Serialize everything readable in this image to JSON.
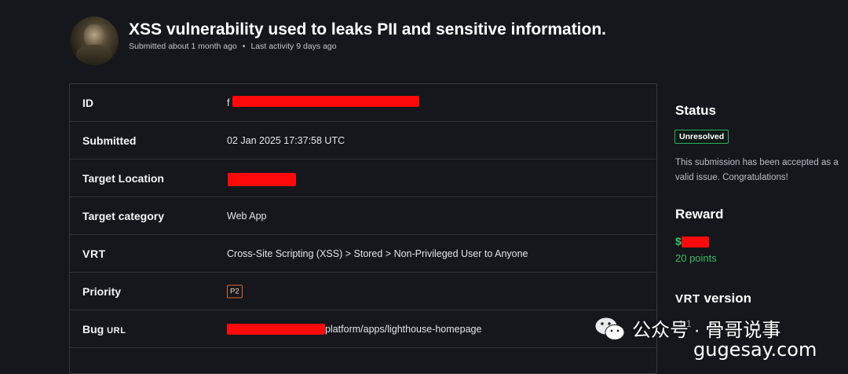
{
  "header": {
    "title": "XSS vulnerability used to leaks PII and sensitive information.",
    "submitted": "Submitted about 1 month ago",
    "separator": "•",
    "last_activity": "Last activity 9 days ago"
  },
  "details": {
    "id": {
      "label": "ID",
      "value_prefix": "f",
      "redacted": true
    },
    "submitted": {
      "label": "Submitted",
      "value": "02 Jan 2025 17:37:58 UTC"
    },
    "target_location": {
      "label": "Target Location",
      "redacted": true
    },
    "target_category": {
      "label": "Target category",
      "value": "Web App"
    },
    "vrt": {
      "label": "VRT",
      "value": "Cross-Site Scripting (XSS) > Stored > Non-Privileged User to Anyone"
    },
    "priority": {
      "label": "Priority",
      "value": "P2"
    },
    "bug_url": {
      "label_word": "Bug",
      "label_acronym": "URL",
      "value_suffix": "platform/apps/lighthouse-homepage",
      "redacted": true
    }
  },
  "sidebar": {
    "status": {
      "heading": "Status",
      "badge": "Unresolved",
      "description": "This submission has been accepted as a valid issue. Congratulations!"
    },
    "reward": {
      "heading": "Reward",
      "currency": "$",
      "points": "20 points"
    },
    "vrt_version": {
      "heading_acronym": "VRT",
      "heading_word": "version",
      "value": "1.1"
    }
  },
  "watermark": {
    "text": "公众号 · 骨哥说事",
    "site": "gugesay.com"
  },
  "colors": {
    "background": "#15171c",
    "redaction": "#ff0a0a",
    "status_green": "#2fae63",
    "points_green": "#3fb964",
    "priority_orange": "#d96a2a"
  }
}
